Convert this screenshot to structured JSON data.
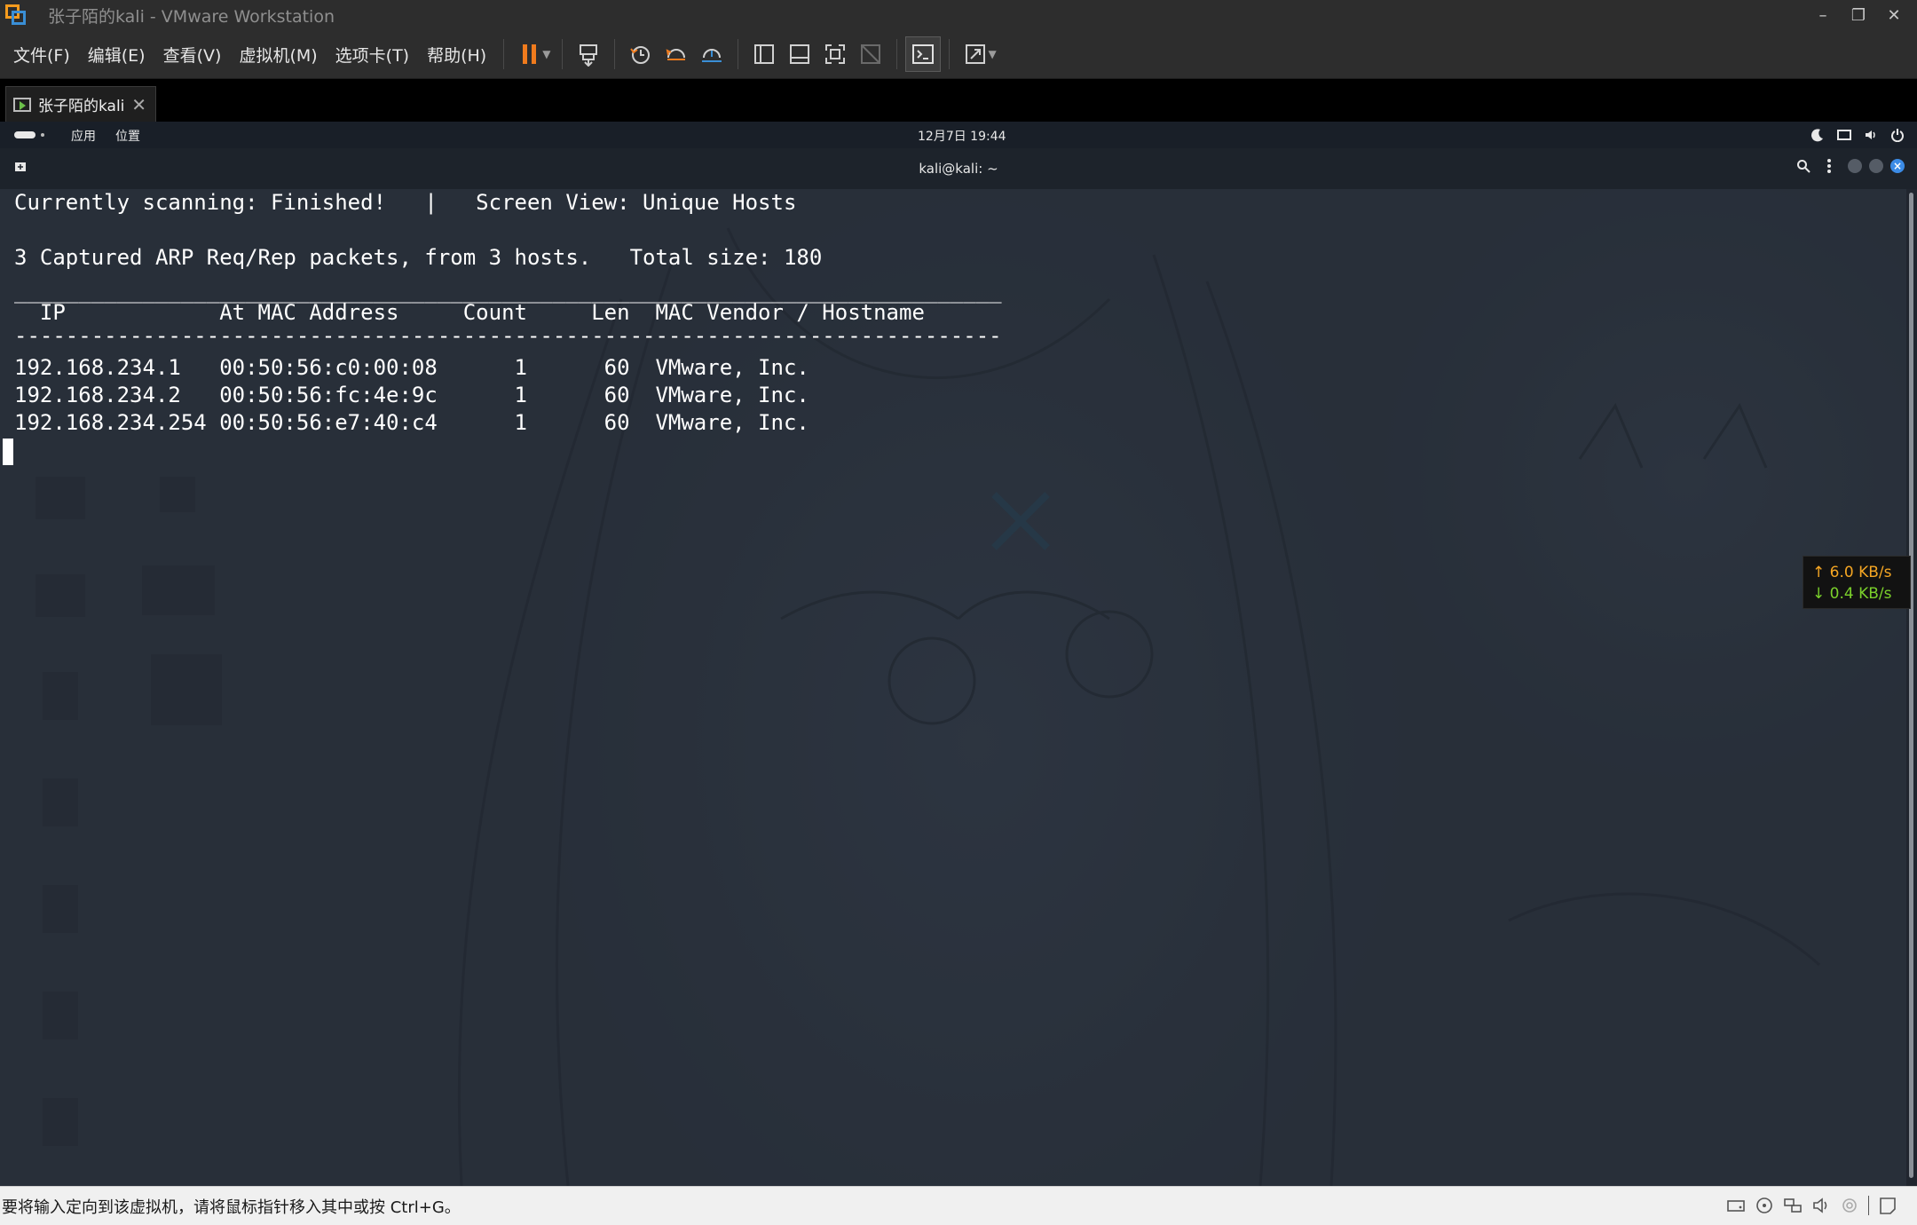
{
  "window": {
    "title": "张子陌的kali - VMware Workstation",
    "controls": {
      "minimize": "–",
      "restore": "❐",
      "close": "✕"
    }
  },
  "menu": {
    "items": [
      "文件(F)",
      "编辑(E)",
      "查看(V)",
      "虚拟机(M)",
      "选项卡(T)",
      "帮助(H)"
    ]
  },
  "toolbar": {
    "buttons": [
      "pause-icon",
      "send-ctrl-alt-del-icon",
      "snapshot-icon",
      "revert-snapshot-icon",
      "snapshot-manager-icon",
      "library-icon",
      "thumbnail-bar-icon",
      "fullscreen-icon",
      "unity-icon",
      "console-view-icon",
      "stretch-icon"
    ],
    "accent": "#f07b1d"
  },
  "tab": {
    "label": "张子陌的kali",
    "close": "✕"
  },
  "kali_panel": {
    "apps": "应用",
    "places": "位置",
    "clock": "12月7日 19:44"
  },
  "terminal": {
    "title": "kali@kali: ~",
    "lines": [
      "Currently scanning: Finished!   |   Screen View: Unique Hosts",
      "3 Captured ARP Req/Rep packets, from 3 hosts.   Total size: 180",
      "_____________________________________________________________________________",
      "  IP            At MAC Address     Count     Len  MAC Vendor / Hostname",
      "-----------------------------------------------------------------------------",
      "192.168.234.1   00:50:56:c0:00:08      1      60  VMware, Inc.",
      "192.168.234.2   00:50:56:fc:4e:9c      1      60  VMware, Inc.",
      "192.168.234.254 00:50:56:e7:40:c4      1      60  VMware, Inc."
    ]
  },
  "netspeed": {
    "up": "↑ 6.0 KB/s",
    "down": "↓ 0.4 KB/s"
  },
  "statusbar": {
    "hint": "要将输入定向到该虚拟机，请将鼠标指针移入其中或按 Ctrl+G。"
  }
}
